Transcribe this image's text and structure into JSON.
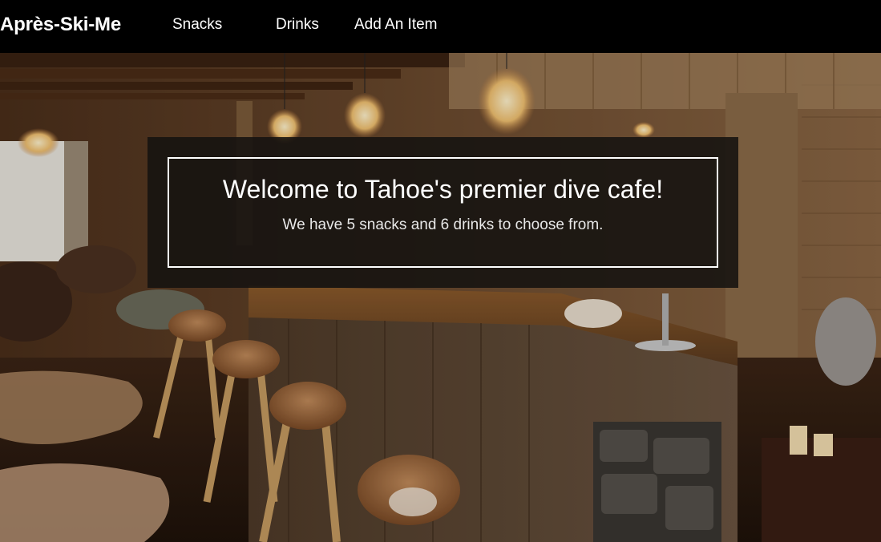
{
  "navbar": {
    "brand": "Après-Ski-Me",
    "links": [
      "Snacks",
      "Drinks",
      "Add An Item"
    ]
  },
  "welcome": {
    "title": "Welcome to Tahoe's premier dive cafe!",
    "subtitle": "We have 5 snacks and 6 drinks to choose from."
  },
  "colors": {
    "navbar_bg": "#000000",
    "text": "#ffffff",
    "overlay_bg": "#141210"
  },
  "images": {
    "hero": "cafe-bar-interior-photo"
  }
}
